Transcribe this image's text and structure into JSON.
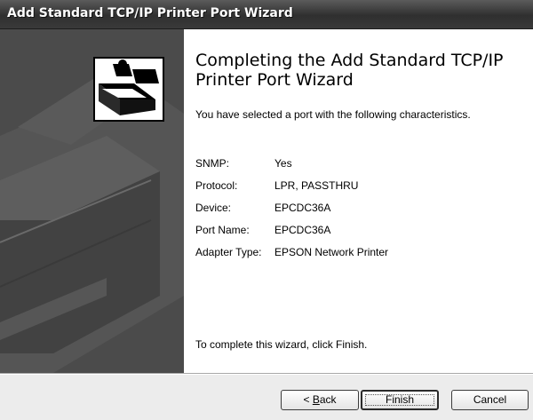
{
  "window": {
    "title": "Add Standard TCP/IP Printer Port Wizard"
  },
  "side_panel": {
    "icon": "printer-wizard-icon"
  },
  "content": {
    "heading": "Completing the Add Standard TCP/IP Printer Port Wizard",
    "intro": "You have selected a port with the following characteristics.",
    "properties": [
      {
        "label": "SNMP:",
        "value": "Yes"
      },
      {
        "label": "Protocol:",
        "value": "LPR, PASSTHRU"
      },
      {
        "label": "Device:",
        "value": "EPCDC36A"
      },
      {
        "label": "Port Name:",
        "value": "EPCDC36A"
      },
      {
        "label": "Adapter Type:",
        "value": "EPSON Network Printer"
      }
    ],
    "finish_note": "To complete this wizard, click Finish."
  },
  "buttons": {
    "back_prefix": "< ",
    "back_accel": "B",
    "back_rest": "ack",
    "finish": "Finish",
    "cancel": "Cancel"
  }
}
